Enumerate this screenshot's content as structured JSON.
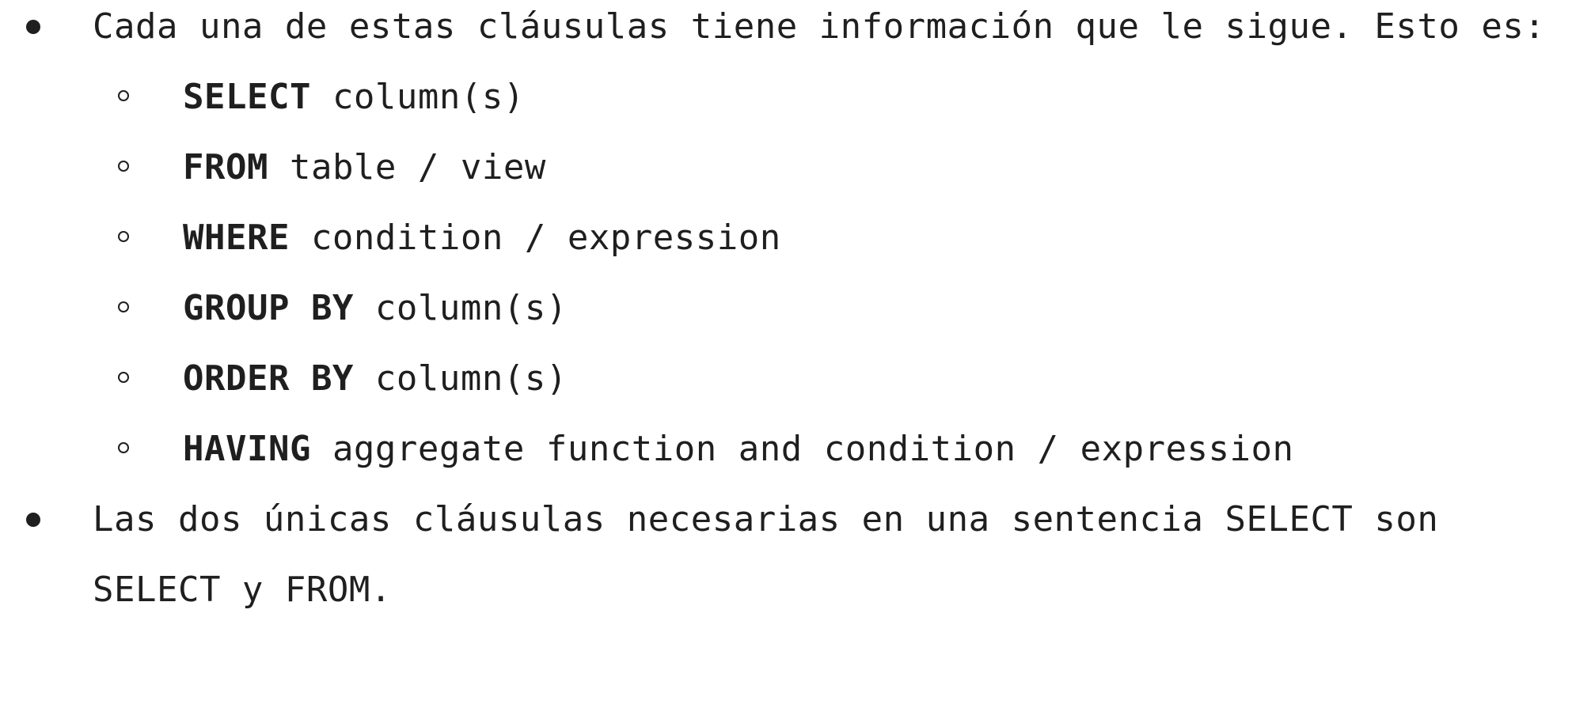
{
  "bullets": [
    {
      "text": "Cada una de estas cláusulas tiene información que le sigue. Esto es:",
      "subitems": [
        {
          "keyword": "SELECT",
          "rest": " column(s)"
        },
        {
          "keyword": "FROM",
          "rest": " table / view"
        },
        {
          "keyword": "WHERE",
          "rest": " condition / expression"
        },
        {
          "keyword": "GROUP BY",
          "rest": " column(s)"
        },
        {
          "keyword": "ORDER BY",
          "rest": " column(s)"
        },
        {
          "keyword": "HAVING",
          "rest": " aggregate function and condition / expression"
        }
      ]
    },
    {
      "text": "Las dos únicas cláusulas necesarias en una sentencia SELECT son SELECT y FROM."
    }
  ],
  "icons": {
    "bullet": "filled-circle-bullet-icon",
    "subbullet": "hollow-circle-bullet-icon"
  }
}
